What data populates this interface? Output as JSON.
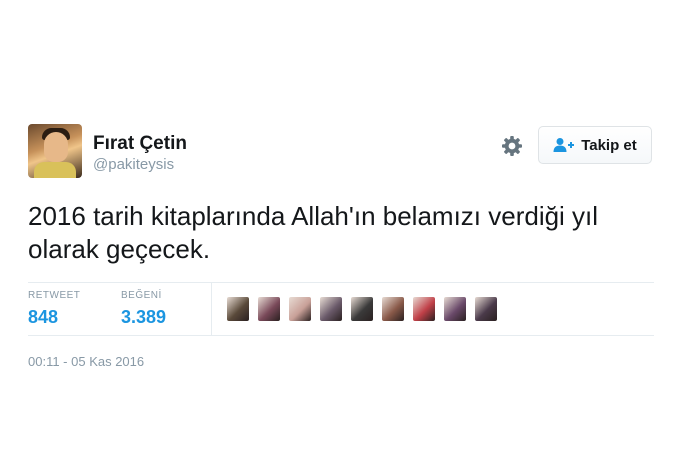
{
  "user": {
    "display_name": "Fırat Çetin",
    "handle": "@pakiteysis"
  },
  "actions": {
    "settings_icon": "gear-icon",
    "follow_icon": "add-user-icon",
    "follow_label": "Takip et"
  },
  "tweet": {
    "text": "2016 tarih kitaplarında Allah'ın belamızı verdiği yıl olarak geçecek."
  },
  "stats": {
    "retweet_label": "RETWEET",
    "retweet_count": "848",
    "like_label": "BEĞENİ",
    "like_count": "3.389"
  },
  "likers": [
    {
      "color": "#5a4a3a"
    },
    {
      "color": "#7a4a5a"
    },
    {
      "color": "#c8a098"
    },
    {
      "color": "#6a5a6a"
    },
    {
      "color": "#3a3a3a"
    },
    {
      "color": "#8a5a4a"
    },
    {
      "color": "#c04048"
    },
    {
      "color": "#6a4a6a"
    },
    {
      "color": "#4a3a4a"
    }
  ],
  "timestamp": "00:11 - 05 Kas 2016",
  "colors": {
    "accent": "#1b95e0",
    "muted": "#8899a6",
    "text": "#14171a"
  }
}
